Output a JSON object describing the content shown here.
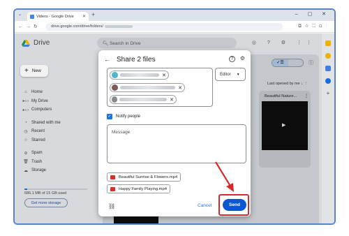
{
  "browser": {
    "tab_title": "Videos - Google Drive",
    "url": "drive.google.com/drive/folders/",
    "new_tab_glyph": "+",
    "window_controls": "–  ▢  ✕"
  },
  "drive": {
    "app_name": "Drive",
    "search_placeholder": "Search in Drive",
    "new_label": "New",
    "nav": [
      {
        "label": "Home",
        "icon": "home-icon"
      },
      {
        "label": "My Drive",
        "icon": "my-drive-icon"
      },
      {
        "label": "Computers",
        "icon": "computers-icon"
      },
      {
        "label": "Shared with me",
        "icon": "shared-icon"
      },
      {
        "label": "Recent",
        "icon": "clock-icon"
      },
      {
        "label": "Starred",
        "icon": "star-icon"
      },
      {
        "label": "Spam",
        "icon": "spam-icon"
      },
      {
        "label": "Trash",
        "icon": "trash-icon"
      },
      {
        "label": "Storage",
        "icon": "cloud-icon"
      }
    ],
    "storage_text": "686.1 MB of 15 GB used",
    "storage_fraction": 0.045,
    "get_more_storage": "Get more storage",
    "sort_label": "Last opened by me",
    "file_card_name": "Beautiful Nature..."
  },
  "dialog": {
    "title": "Share 2 files",
    "role": "Editor",
    "notify_label": "Notify people",
    "notify_checked": true,
    "message_placeholder": "Message",
    "attachments": [
      "Beautiful Sunrise & Flowers.mp4",
      "Happy Family Playing.mp4"
    ],
    "cancel_label": "Cancel",
    "send_label": "Send"
  },
  "colors": {
    "accent": "#1a73e8",
    "send_button": "#0b57d0",
    "highlight": "#d62b2b",
    "frame": "#5b84c8"
  }
}
